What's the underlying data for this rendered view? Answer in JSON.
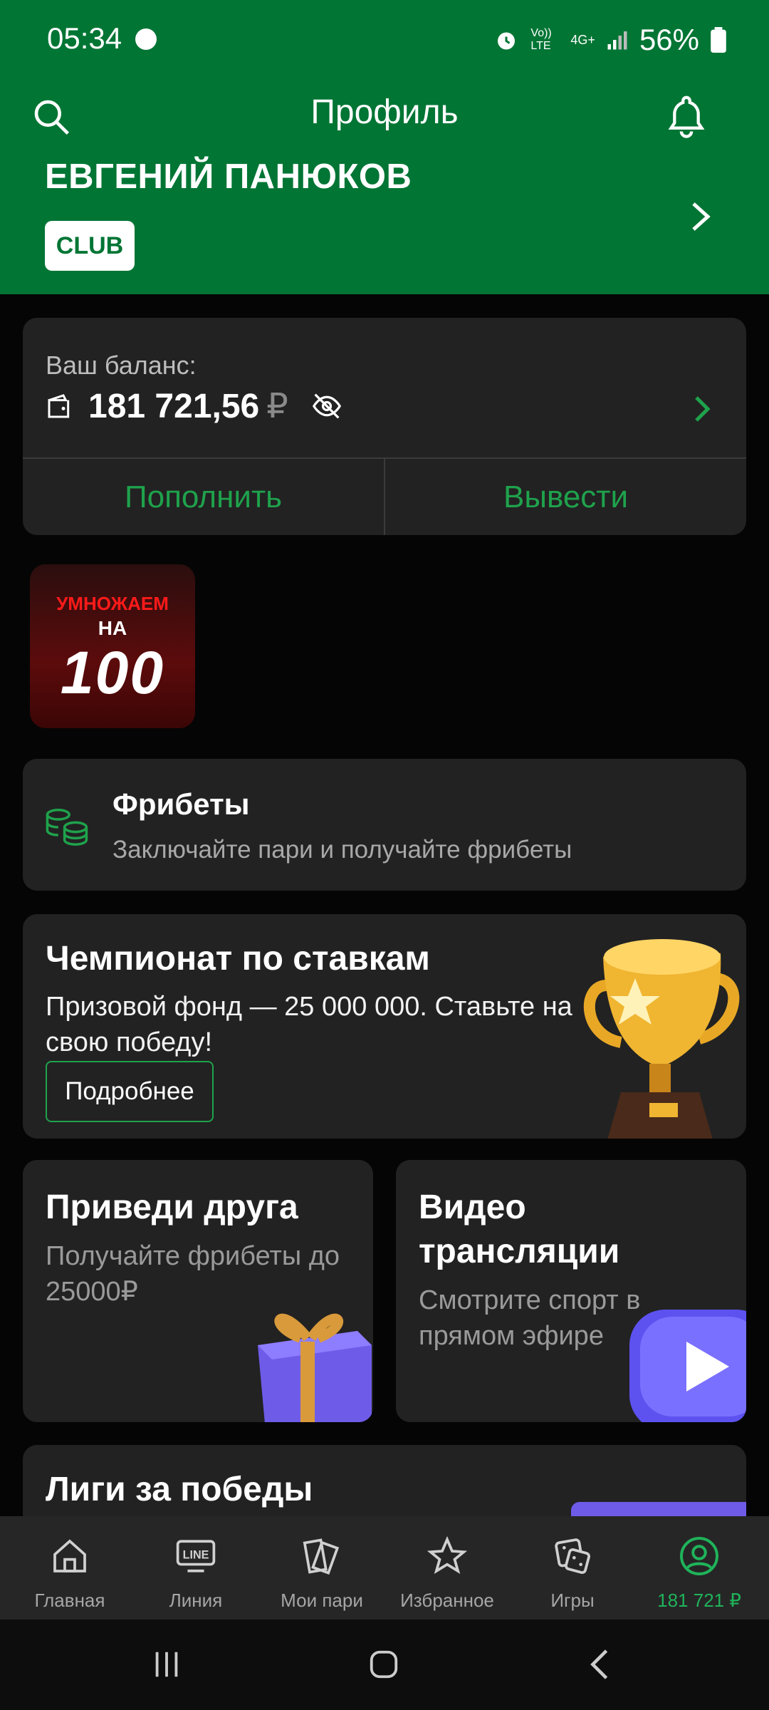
{
  "status": {
    "time": "05:34",
    "battery": "56%",
    "network": "4G+",
    "volte": "Vo)) LTE"
  },
  "header": {
    "title": "Профиль",
    "user_name": "ЕВГЕНИЙ ПАНЮКОВ",
    "badge": "CLUB"
  },
  "balance": {
    "label": "Ваш баланс:",
    "amount": "181 721,56",
    "currency": "₽",
    "deposit": "Пополнить",
    "withdraw": "Вывести"
  },
  "promo": {
    "line1": "УМНОЖАЕМ",
    "line2": "НА",
    "line3": "100"
  },
  "freebets": {
    "title": "Фрибеты",
    "subtitle": "Заключайте пари и получайте фрибеты"
  },
  "championship": {
    "title": "Чемпионат по ставкам",
    "text": "Призовой фонд — 25 000 000. Ставьте на свою победу!",
    "button": "Подробнее"
  },
  "referral": {
    "title": "Приведи друга",
    "subtitle": "Получайте фрибеты до 25000₽"
  },
  "video": {
    "title": "Видео трансляции",
    "subtitle": "Смотрите спорт в прямом эфире"
  },
  "leagues": {
    "title": "Лиги за победы"
  },
  "nav": [
    {
      "label": "Главная",
      "icon": "home-icon"
    },
    {
      "label": "Линия",
      "icon": "line-icon"
    },
    {
      "label": "Мои пари",
      "icon": "tickets-icon"
    },
    {
      "label": "Избранное",
      "icon": "star-icon"
    },
    {
      "label": "Игры",
      "icon": "dice-icon"
    },
    {
      "label": "181 721 ₽",
      "icon": "profile-icon"
    }
  ],
  "colors": {
    "brand": "#007534",
    "accent": "#1fa24c",
    "card": "#222222"
  }
}
